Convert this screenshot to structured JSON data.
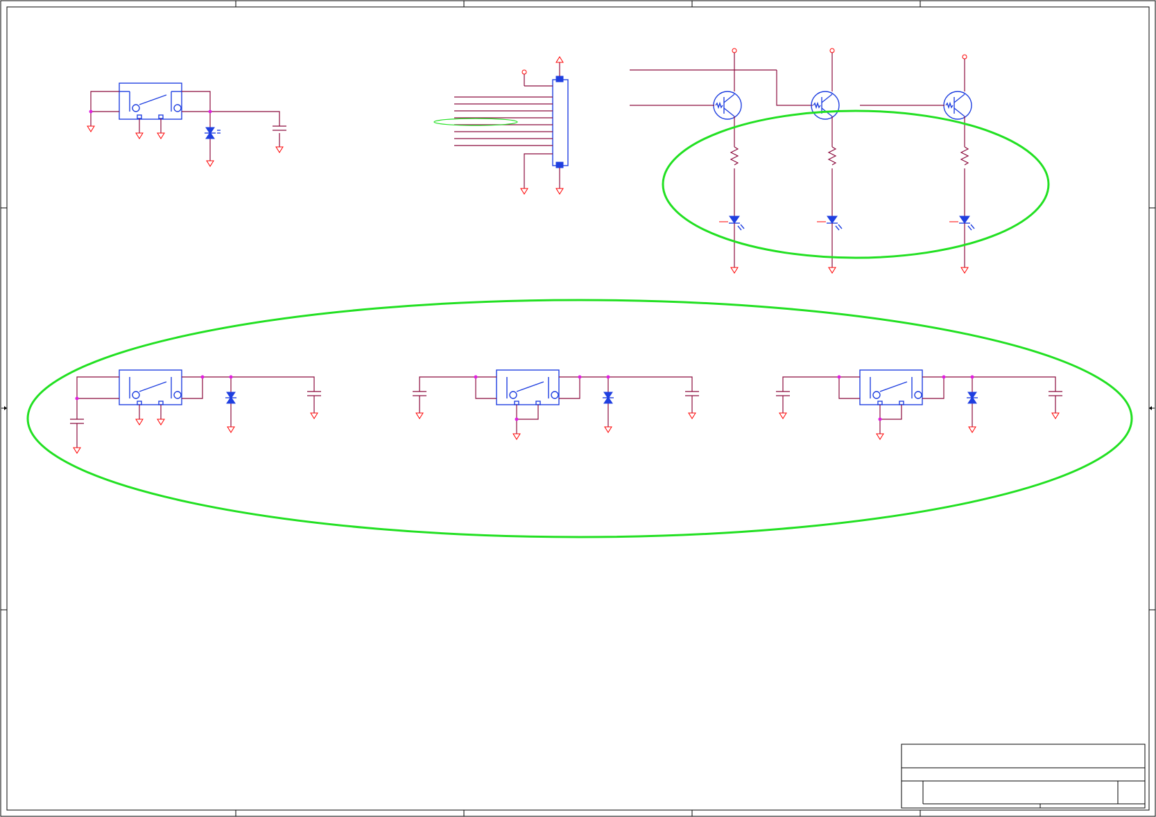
{
  "colors": {
    "wire": "#8b0a3c",
    "ground_symbol": "#ff0000",
    "component": "#1f3fe0",
    "junction": "#e020e0",
    "highlight": "#22e022",
    "frame": "#000000"
  },
  "diagram": {
    "type": "electrical-schematic",
    "sheet_frame_columns": 5,
    "sheet_frame_rows": 4,
    "top_left_switch": {
      "component": "push-button-switch",
      "parts": [
        "switch",
        "tvs-diode",
        "capacitor"
      ],
      "ground_count": 5
    },
    "connector": {
      "component": "multi-pin-connector",
      "signal_lines": 10,
      "highlighted_line_index": 4
    },
    "led_drivers": {
      "count": 3,
      "parts_per_channel": [
        "digital-transistor",
        "resistor",
        "led"
      ],
      "highlighted": true
    },
    "bottom_switches": {
      "count": 3,
      "parts_per_channel": [
        "capacitor",
        "push-button-switch",
        "tvs-diode",
        "capacitor"
      ],
      "highlighted": true
    },
    "title_block": {
      "rows": 3
    }
  }
}
